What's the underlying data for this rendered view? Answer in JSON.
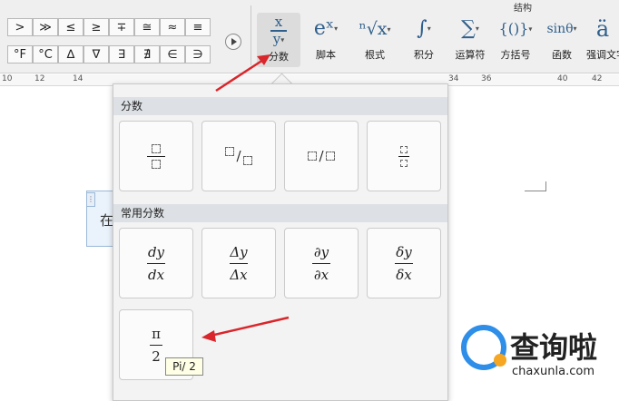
{
  "toolbar": {
    "section_title": "结构",
    "symbols_row1": [
      ">",
      "≫",
      "≤",
      "≥",
      "∓",
      "≅",
      "≈",
      "≡"
    ],
    "symbols_row2": [
      "°F",
      "°C",
      "∆",
      "∇",
      "∃",
      "∄",
      "∈",
      "∋"
    ],
    "tools": [
      {
        "label": "分数",
        "icon": "fraction-icon",
        "active": true
      },
      {
        "label": "脚本",
        "icon": "script-icon",
        "active": false
      },
      {
        "label": "根式",
        "icon": "radical-icon",
        "active": false
      },
      {
        "label": "积分",
        "icon": "integral-icon",
        "active": false
      },
      {
        "label": "运算符",
        "icon": "large-operator-icon",
        "active": false
      },
      {
        "label": "方括号",
        "icon": "bracket-icon",
        "active": false
      },
      {
        "label": "函数",
        "icon": "function-icon",
        "active": false
      },
      {
        "label": "强调文字",
        "icon": "accent-icon",
        "active": false
      }
    ],
    "tool_glyphs": {
      "script": "eˣ",
      "radical": "ⁿ√x",
      "integral": "∫",
      "operator": "∑",
      "bracket": "{()}",
      "function": "sinθ",
      "accent": "ä"
    }
  },
  "ruler": {
    "ticks": [
      "10",
      "12",
      "14",
      "34",
      "36",
      "40",
      "42"
    ]
  },
  "document": {
    "text_fragment": "在"
  },
  "dropdown": {
    "section1_title": "分数",
    "section2_title": "常用分数",
    "common": [
      {
        "num": "dy",
        "den": "dx"
      },
      {
        "num": "Δy",
        "den": "Δx"
      },
      {
        "num": "∂y",
        "den": "∂x"
      },
      {
        "num": "δy",
        "den": "δx"
      },
      {
        "num": "π",
        "den": "2"
      }
    ],
    "tooltip": "Pi/ 2"
  },
  "watermark": {
    "brand_cn": "查询啦",
    "brand_en": "chaxunla.com"
  },
  "colors": {
    "accent": "#2f5f8c",
    "arrow": "#d9262c",
    "brand": "#2e8ee8"
  }
}
